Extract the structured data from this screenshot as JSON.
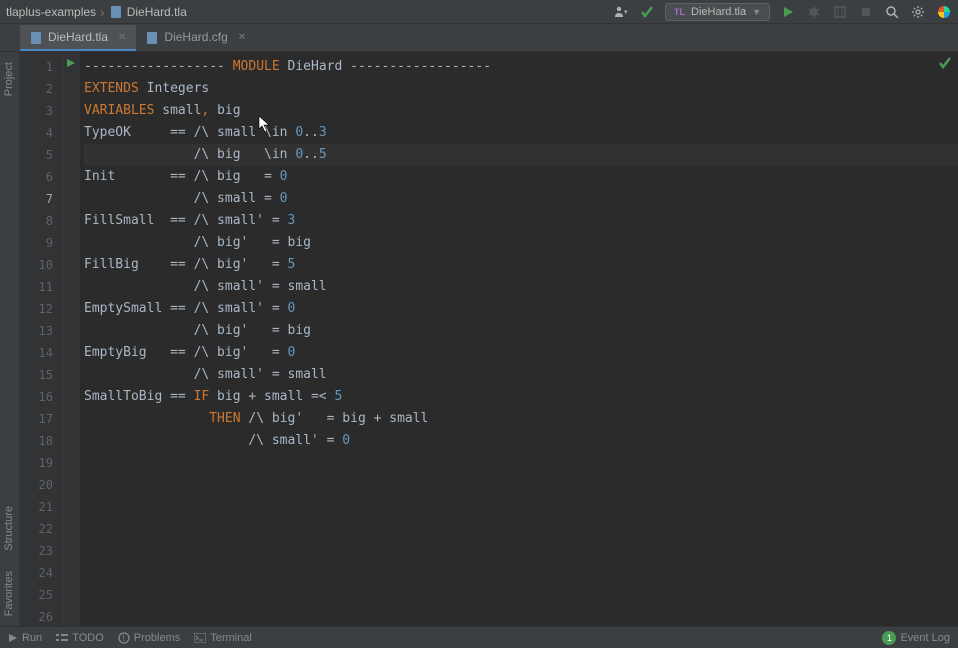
{
  "breadcrumb": {
    "project": "tlaplus-examples",
    "file": "DieHard.tla"
  },
  "run_config": {
    "name": "DieHard.tla"
  },
  "tabs": [
    {
      "name": "DieHard.tla",
      "active": true
    },
    {
      "name": "DieHard.cfg",
      "active": false
    }
  ],
  "sidebar": {
    "project": "Project",
    "structure": "Structure",
    "favorites": "Favorites"
  },
  "editor": {
    "current_line": 7,
    "lines": [
      {
        "n": 1,
        "segs": [
          {
            "t": "------------------ ",
            "c": ""
          },
          {
            "t": "MODULE",
            "c": "kw"
          },
          {
            "t": " DieHard ",
            "c": ""
          },
          {
            "t": "------------------",
            "c": ""
          }
        ]
      },
      {
        "n": 2,
        "segs": [
          {
            "t": "EXTENDS",
            "c": "kw"
          },
          {
            "t": " Integers",
            "c": ""
          }
        ]
      },
      {
        "n": 3,
        "segs": [
          {
            "t": "",
            "c": ""
          }
        ]
      },
      {
        "n": 4,
        "segs": [
          {
            "t": "VARIABLES",
            "c": "kw"
          },
          {
            "t": " small",
            "c": ""
          },
          {
            "t": ",",
            "c": "punct"
          },
          {
            "t": " big",
            "c": ""
          }
        ]
      },
      {
        "n": 5,
        "segs": [
          {
            "t": "",
            "c": ""
          }
        ]
      },
      {
        "n": 6,
        "segs": [
          {
            "t": "TypeOK     == /\\ small \\in ",
            "c": ""
          },
          {
            "t": "0",
            "c": "num"
          },
          {
            "t": "..",
            "c": ""
          },
          {
            "t": "3",
            "c": "num"
          }
        ]
      },
      {
        "n": 7,
        "segs": [
          {
            "t": "              /\\ big   \\in ",
            "c": ""
          },
          {
            "t": "0",
            "c": "num"
          },
          {
            "t": "..",
            "c": ""
          },
          {
            "t": "5",
            "c": "num"
          }
        ]
      },
      {
        "n": 8,
        "segs": [
          {
            "t": "",
            "c": ""
          }
        ]
      },
      {
        "n": 9,
        "segs": [
          {
            "t": "Init       == /\\ big   = ",
            "c": ""
          },
          {
            "t": "0",
            "c": "num"
          }
        ]
      },
      {
        "n": 10,
        "segs": [
          {
            "t": "              /\\ small = ",
            "c": ""
          },
          {
            "t": "0",
            "c": "num"
          }
        ]
      },
      {
        "n": 11,
        "segs": [
          {
            "t": "",
            "c": ""
          }
        ]
      },
      {
        "n": 12,
        "segs": [
          {
            "t": "FillSmall  == /\\ small' = ",
            "c": ""
          },
          {
            "t": "3",
            "c": "num"
          }
        ]
      },
      {
        "n": 13,
        "segs": [
          {
            "t": "              /\\ big'   = big",
            "c": ""
          }
        ]
      },
      {
        "n": 14,
        "segs": [
          {
            "t": "",
            "c": ""
          }
        ]
      },
      {
        "n": 15,
        "segs": [
          {
            "t": "FillBig    == /\\ big'   = ",
            "c": ""
          },
          {
            "t": "5",
            "c": "num"
          }
        ]
      },
      {
        "n": 16,
        "segs": [
          {
            "t": "              /\\ small' = small",
            "c": ""
          }
        ]
      },
      {
        "n": 17,
        "segs": [
          {
            "t": "",
            "c": ""
          }
        ]
      },
      {
        "n": 18,
        "segs": [
          {
            "t": "EmptySmall == /\\ small' = ",
            "c": ""
          },
          {
            "t": "0",
            "c": "num"
          }
        ]
      },
      {
        "n": 19,
        "segs": [
          {
            "t": "              /\\ big'   = big",
            "c": ""
          }
        ]
      },
      {
        "n": 20,
        "segs": [
          {
            "t": "",
            "c": ""
          }
        ]
      },
      {
        "n": 21,
        "segs": [
          {
            "t": "EmptyBig   == /\\ big'   = ",
            "c": ""
          },
          {
            "t": "0",
            "c": "num"
          }
        ]
      },
      {
        "n": 22,
        "segs": [
          {
            "t": "              /\\ small' = small",
            "c": ""
          }
        ]
      },
      {
        "n": 23,
        "segs": [
          {
            "t": "",
            "c": ""
          }
        ]
      },
      {
        "n": 24,
        "segs": [
          {
            "t": "SmallToBig == ",
            "c": ""
          },
          {
            "t": "IF",
            "c": "kw"
          },
          {
            "t": " big + small =< ",
            "c": ""
          },
          {
            "t": "5",
            "c": "num"
          }
        ]
      },
      {
        "n": 25,
        "segs": [
          {
            "t": "                ",
            "c": ""
          },
          {
            "t": "THEN",
            "c": "kw"
          },
          {
            "t": " /\\ big'   = big + small",
            "c": ""
          }
        ]
      },
      {
        "n": 26,
        "segs": [
          {
            "t": "                     /\\ small' = ",
            "c": ""
          },
          {
            "t": "0",
            "c": "num"
          }
        ]
      }
    ]
  },
  "bottom": {
    "run": "Run",
    "todo": "TODO",
    "problems": "Problems",
    "terminal": "Terminal",
    "event_count": "1",
    "event_log": "Event Log"
  }
}
